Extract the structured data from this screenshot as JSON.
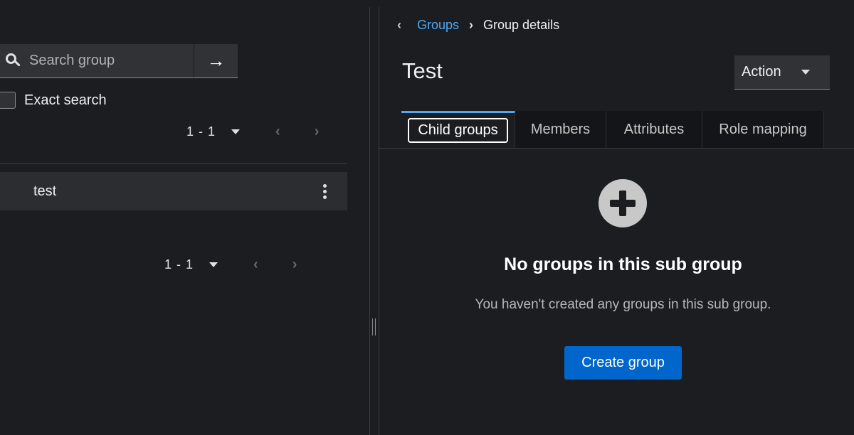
{
  "search": {
    "placeholder": "Search group",
    "submit_icon": "→",
    "exact_label": "Exact search"
  },
  "pagination_top": {
    "range": "1 - 1"
  },
  "pagination_bottom": {
    "range": "1 - 1"
  },
  "groups": [
    {
      "name": "test"
    }
  ],
  "breadcrumb": {
    "back_icon": "‹",
    "parent": "Groups",
    "separator": "›",
    "current": "Group details"
  },
  "details": {
    "title": "Test",
    "action_label": "Action"
  },
  "tabs": [
    {
      "label": "Child groups",
      "active": true
    },
    {
      "label": "Members"
    },
    {
      "label": "Attributes"
    },
    {
      "label": "Role mapping"
    }
  ],
  "empty_state": {
    "title": "No groups in this sub group",
    "body": "You haven't created any groups in this sub group.",
    "button": "Create group"
  },
  "colors": {
    "background": "#1b1d21",
    "link": "#4ea8f4",
    "primary": "#0066cc"
  }
}
